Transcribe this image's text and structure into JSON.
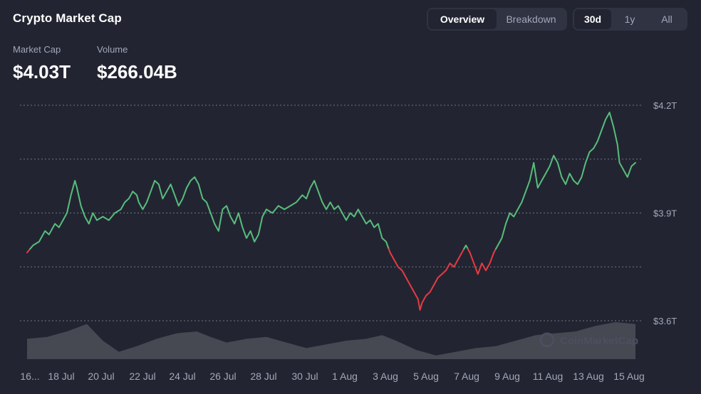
{
  "title": "Crypto Market Cap",
  "tabs_view": [
    {
      "label": "Overview",
      "active": true
    },
    {
      "label": "Breakdown",
      "active": false
    }
  ],
  "tabs_range": [
    {
      "label": "30d",
      "active": true
    },
    {
      "label": "1y",
      "active": false
    },
    {
      "label": "All",
      "active": false
    }
  ],
  "stats": {
    "market_cap_label": "Market Cap",
    "market_cap_value": "$4.03T",
    "volume_label": "Volume",
    "volume_value": "$266.04B"
  },
  "watermark": "CoinMarketCap",
  "colors": {
    "background": "#222531",
    "up": "#58bd7d",
    "down": "#ea3943",
    "volume": "#4a4d57",
    "grid": "#8a8fa0",
    "muted": "#a1a7bb"
  },
  "chart_data": {
    "type": "line",
    "x_ticks": [
      "16...",
      "18 Jul",
      "20 Jul",
      "22 Jul",
      "24 Jul",
      "26 Jul",
      "28 Jul",
      "30 Jul",
      "1 Aug",
      "3 Aug",
      "5 Aug",
      "7 Aug",
      "9 Aug",
      "11 Aug",
      "13 Aug",
      "15 Aug"
    ],
    "y_ticks": [
      {
        "value": 4.2,
        "label": "$4.2T"
      },
      {
        "value": 3.9,
        "label": "$3.9T"
      },
      {
        "value": 3.6,
        "label": "$3.6T"
      }
    ],
    "ylim": [
      3.6,
      4.2
    ],
    "xlim": [
      0,
      30.5
    ],
    "baseline": 3.8,
    "grid": true,
    "market_cap_trillions": [
      [
        0,
        3.79
      ],
      [
        0.3,
        3.81
      ],
      [
        0.6,
        3.82
      ],
      [
        0.9,
        3.85
      ],
      [
        1.1,
        3.84
      ],
      [
        1.4,
        3.87
      ],
      [
        1.6,
        3.86
      ],
      [
        1.8,
        3.88
      ],
      [
        2.0,
        3.9
      ],
      [
        2.2,
        3.95
      ],
      [
        2.4,
        3.99
      ],
      [
        2.5,
        3.97
      ],
      [
        2.7,
        3.92
      ],
      [
        2.9,
        3.89
      ],
      [
        3.1,
        3.87
      ],
      [
        3.3,
        3.9
      ],
      [
        3.5,
        3.88
      ],
      [
        3.8,
        3.89
      ],
      [
        4.1,
        3.88
      ],
      [
        4.4,
        3.9
      ],
      [
        4.7,
        3.91
      ],
      [
        4.9,
        3.93
      ],
      [
        5.1,
        3.94
      ],
      [
        5.3,
        3.96
      ],
      [
        5.5,
        3.95
      ],
      [
        5.6,
        3.93
      ],
      [
        5.8,
        3.91
      ],
      [
        6.0,
        3.93
      ],
      [
        6.2,
        3.96
      ],
      [
        6.4,
        3.99
      ],
      [
        6.6,
        3.98
      ],
      [
        6.8,
        3.94
      ],
      [
        7.0,
        3.96
      ],
      [
        7.2,
        3.98
      ],
      [
        7.4,
        3.95
      ],
      [
        7.6,
        3.92
      ],
      [
        7.8,
        3.94
      ],
      [
        8.0,
        3.97
      ],
      [
        8.2,
        3.99
      ],
      [
        8.4,
        4.0
      ],
      [
        8.6,
        3.98
      ],
      [
        8.8,
        3.94
      ],
      [
        9.0,
        3.93
      ],
      [
        9.2,
        3.9
      ],
      [
        9.4,
        3.87
      ],
      [
        9.6,
        3.85
      ],
      [
        9.8,
        3.91
      ],
      [
        10.0,
        3.92
      ],
      [
        10.2,
        3.89
      ],
      [
        10.4,
        3.87
      ],
      [
        10.6,
        3.9
      ],
      [
        10.8,
        3.86
      ],
      [
        11.0,
        3.83
      ],
      [
        11.2,
        3.85
      ],
      [
        11.4,
        3.82
      ],
      [
        11.6,
        3.84
      ],
      [
        11.8,
        3.89
      ],
      [
        12.0,
        3.91
      ],
      [
        12.3,
        3.9
      ],
      [
        12.6,
        3.92
      ],
      [
        12.9,
        3.91
      ],
      [
        13.2,
        3.92
      ],
      [
        13.5,
        3.93
      ],
      [
        13.8,
        3.95
      ],
      [
        14.0,
        3.94
      ],
      [
        14.2,
        3.97
      ],
      [
        14.4,
        3.99
      ],
      [
        14.6,
        3.96
      ],
      [
        14.8,
        3.93
      ],
      [
        15.0,
        3.91
      ],
      [
        15.2,
        3.93
      ],
      [
        15.4,
        3.91
      ],
      [
        15.6,
        3.92
      ],
      [
        15.8,
        3.9
      ],
      [
        16.0,
        3.88
      ],
      [
        16.2,
        3.9
      ],
      [
        16.4,
        3.89
      ],
      [
        16.6,
        3.91
      ],
      [
        16.8,
        3.89
      ],
      [
        17.0,
        3.87
      ],
      [
        17.2,
        3.88
      ],
      [
        17.4,
        3.86
      ],
      [
        17.6,
        3.87
      ],
      [
        17.8,
        3.83
      ],
      [
        18.0,
        3.82
      ],
      [
        18.2,
        3.79
      ],
      [
        18.4,
        3.77
      ],
      [
        18.6,
        3.75
      ],
      [
        18.8,
        3.74
      ],
      [
        19.0,
        3.72
      ],
      [
        19.2,
        3.7
      ],
      [
        19.4,
        3.68
      ],
      [
        19.6,
        3.66
      ],
      [
        19.7,
        3.63
      ],
      [
        19.8,
        3.65
      ],
      [
        20.0,
        3.67
      ],
      [
        20.2,
        3.68
      ],
      [
        20.4,
        3.7
      ],
      [
        20.6,
        3.72
      ],
      [
        20.8,
        3.73
      ],
      [
        21.0,
        3.74
      ],
      [
        21.2,
        3.76
      ],
      [
        21.4,
        3.75
      ],
      [
        21.6,
        3.77
      ],
      [
        21.8,
        3.79
      ],
      [
        22.0,
        3.81
      ],
      [
        22.2,
        3.79
      ],
      [
        22.4,
        3.76
      ],
      [
        22.6,
        3.73
      ],
      [
        22.8,
        3.76
      ],
      [
        23.0,
        3.74
      ],
      [
        23.2,
        3.76
      ],
      [
        23.4,
        3.79
      ],
      [
        23.6,
        3.81
      ],
      [
        23.8,
        3.83
      ],
      [
        24.0,
        3.87
      ],
      [
        24.2,
        3.9
      ],
      [
        24.4,
        3.89
      ],
      [
        24.6,
        3.91
      ],
      [
        24.8,
        3.93
      ],
      [
        25.0,
        3.96
      ],
      [
        25.2,
        3.99
      ],
      [
        25.4,
        4.04
      ],
      [
        25.6,
        3.97
      ],
      [
        25.8,
        3.99
      ],
      [
        26.0,
        4.01
      ],
      [
        26.2,
        4.03
      ],
      [
        26.4,
        4.06
      ],
      [
        26.6,
        4.04
      ],
      [
        26.8,
        4.0
      ],
      [
        27.0,
        3.98
      ],
      [
        27.2,
        4.01
      ],
      [
        27.4,
        3.99
      ],
      [
        27.6,
        3.98
      ],
      [
        27.8,
        4.0
      ],
      [
        28.0,
        4.04
      ],
      [
        28.2,
        4.07
      ],
      [
        28.4,
        4.08
      ],
      [
        28.6,
        4.1
      ],
      [
        28.8,
        4.13
      ],
      [
        29.0,
        4.16
      ],
      [
        29.2,
        4.18
      ],
      [
        29.4,
        4.14
      ],
      [
        29.6,
        4.09
      ],
      [
        29.7,
        4.04
      ],
      [
        29.9,
        4.02
      ],
      [
        30.1,
        4.0
      ],
      [
        30.3,
        4.03
      ],
      [
        30.5,
        4.04
      ]
    ],
    "volume_relative": [
      [
        0,
        0.55
      ],
      [
        1,
        0.6
      ],
      [
        2,
        0.75
      ],
      [
        3,
        0.95
      ],
      [
        3.8,
        0.5
      ],
      [
        4.6,
        0.2
      ],
      [
        5.5,
        0.35
      ],
      [
        6.5,
        0.55
      ],
      [
        7.5,
        0.7
      ],
      [
        8.5,
        0.75
      ],
      [
        9.2,
        0.6
      ],
      [
        10,
        0.45
      ],
      [
        11,
        0.55
      ],
      [
        12,
        0.6
      ],
      [
        13,
        0.45
      ],
      [
        14,
        0.3
      ],
      [
        15,
        0.4
      ],
      [
        16,
        0.5
      ],
      [
        17,
        0.55
      ],
      [
        17.8,
        0.65
      ],
      [
        18.5,
        0.5
      ],
      [
        19.5,
        0.25
      ],
      [
        20.5,
        0.1
      ],
      [
        21.5,
        0.2
      ],
      [
        22.5,
        0.3
      ],
      [
        23.5,
        0.35
      ],
      [
        24.5,
        0.5
      ],
      [
        25.5,
        0.65
      ],
      [
        26.5,
        0.7
      ],
      [
        27.5,
        0.75
      ],
      [
        28.5,
        0.9
      ],
      [
        29.5,
        1.0
      ],
      [
        30.5,
        0.95
      ]
    ]
  }
}
